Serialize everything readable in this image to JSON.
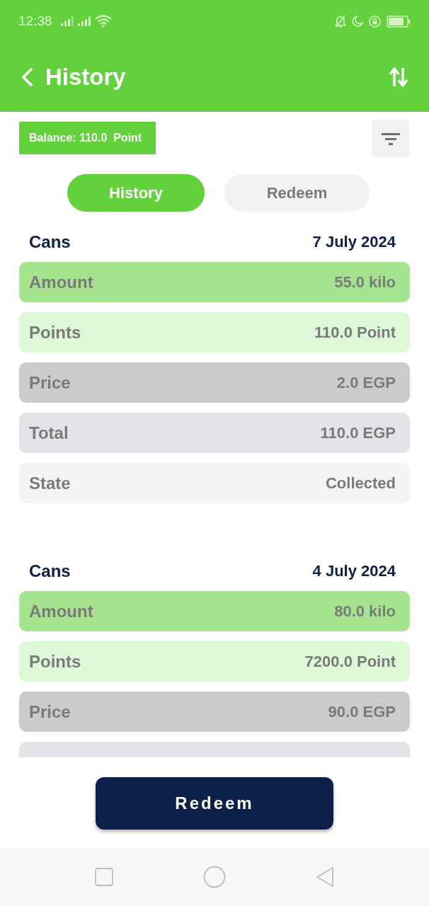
{
  "status_bar": {
    "time": "12:38"
  },
  "header": {
    "title": "History"
  },
  "balance": {
    "label": "Balance: 110.0  Point"
  },
  "tabs": [
    {
      "label": "History",
      "selected": true
    },
    {
      "label": "Redeem",
      "selected": false
    }
  ],
  "records": [
    {
      "title": "Cans",
      "date": "7 July 2024",
      "rows": [
        {
          "kind": "amount",
          "label": "Amount",
          "value": "55.0 kilo"
        },
        {
          "kind": "points",
          "label": "Points",
          "value": "110.0 Point"
        },
        {
          "kind": "price",
          "label": "Price",
          "value": "2.0 EGP"
        },
        {
          "kind": "total",
          "label": "Total",
          "value": "110.0 EGP"
        },
        {
          "kind": "state",
          "label": "State",
          "value": "Collected"
        }
      ]
    },
    {
      "title": "Cans",
      "date": "4 July 2024",
      "rows": [
        {
          "kind": "amount",
          "label": "Amount",
          "value": "80.0 kilo"
        },
        {
          "kind": "points",
          "label": "Points",
          "value": "7200.0 Point"
        },
        {
          "kind": "price",
          "label": "Price",
          "value": "90.0 EGP"
        },
        {
          "kind": "total"
        }
      ]
    }
  ],
  "redeem_button": {
    "label": "Redeem"
  }
}
